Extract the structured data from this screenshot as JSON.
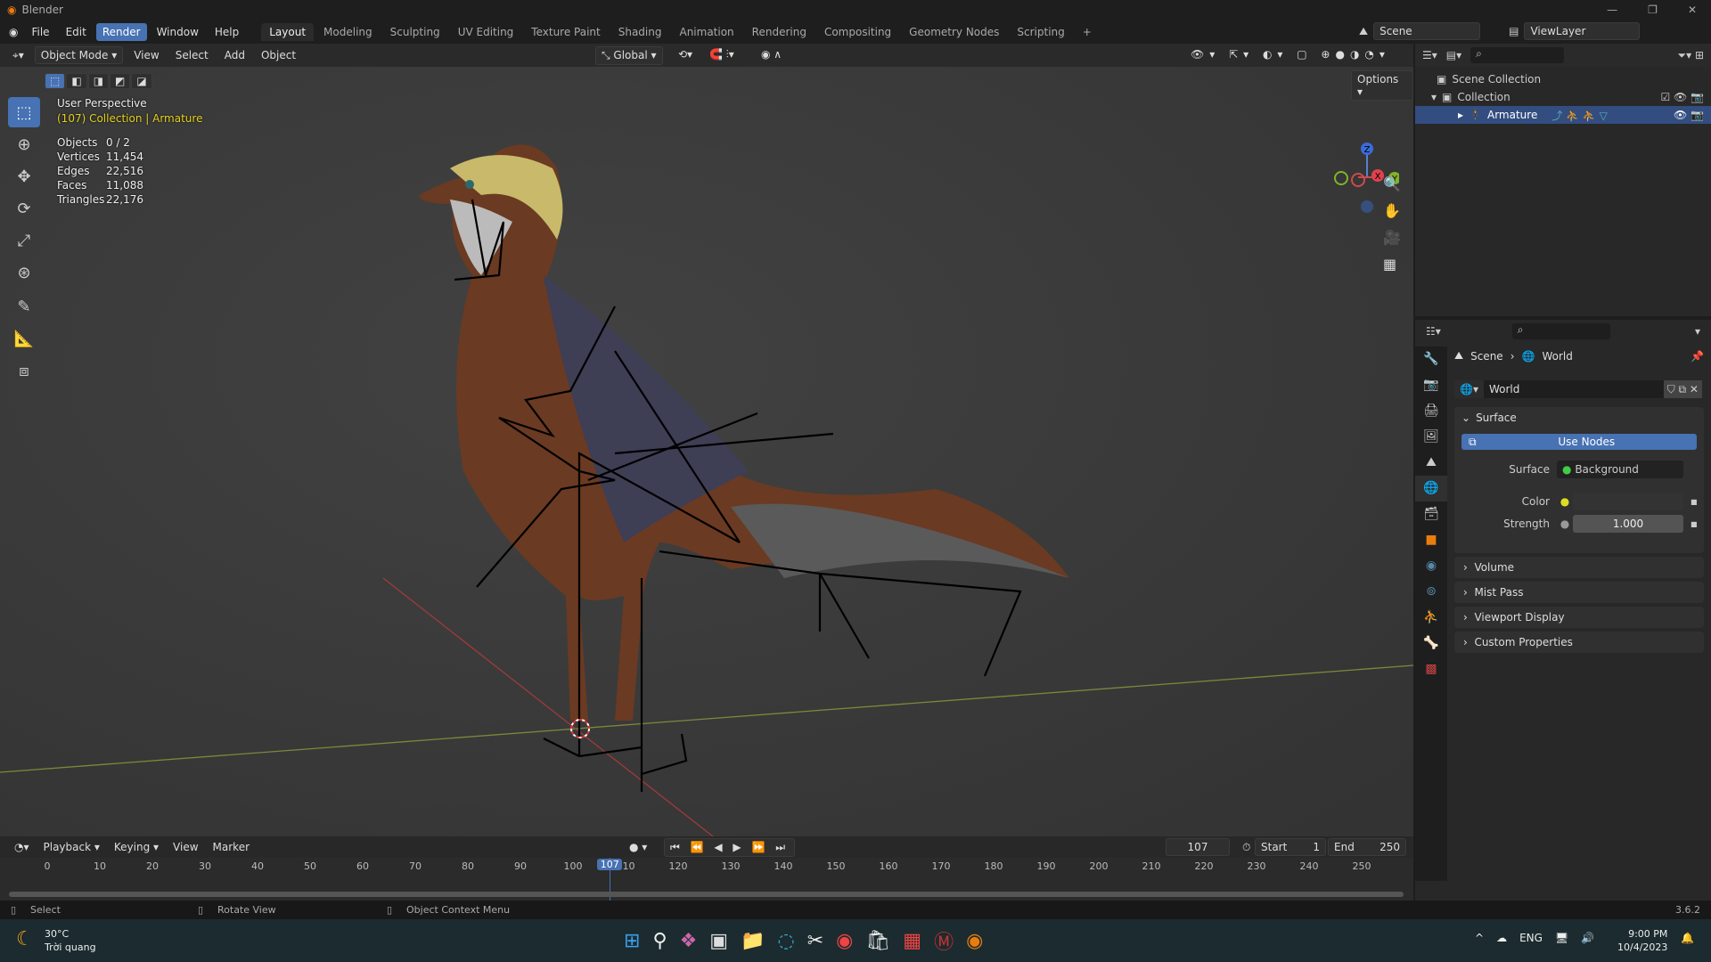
{
  "window": {
    "title": "Blender"
  },
  "menu": [
    "File",
    "Edit",
    "Render",
    "Window",
    "Help"
  ],
  "active_menu": "Render",
  "workspaces": [
    "Layout",
    "Modeling",
    "Sculpting",
    "UV Editing",
    "Texture Paint",
    "Shading",
    "Animation",
    "Rendering",
    "Compositing",
    "Geometry Nodes",
    "Scripting",
    "+"
  ],
  "active_workspace": "Layout",
  "scene": "Scene",
  "view_layer": "ViewLayer",
  "viewport": {
    "mode": "Object Mode",
    "menus": [
      "View",
      "Select",
      "Add",
      "Object"
    ],
    "orientation": "Global",
    "options": "Options",
    "perspective": "User Perspective",
    "context": "(107) Collection | Armature",
    "stats": [
      {
        "label": "Objects",
        "value": "0 / 2"
      },
      {
        "label": "Vertices",
        "value": "11,454"
      },
      {
        "label": "Edges",
        "value": "22,516"
      },
      {
        "label": "Faces",
        "value": "11,088"
      },
      {
        "label": "Triangles",
        "value": "22,176"
      }
    ],
    "gizmo": {
      "x": "X",
      "y": "Y",
      "z": "Z"
    }
  },
  "outliner": {
    "root": "Scene Collection",
    "collection": "Collection",
    "item": "Armature"
  },
  "properties": {
    "breadcrumb": [
      "Scene",
      "World"
    ],
    "world_name": "World",
    "surface_header": "Surface",
    "use_nodes": "Use Nodes",
    "surface_label": "Surface",
    "surface_value": "Background",
    "color_label": "Color",
    "strength_label": "Strength",
    "strength_value": "1.000",
    "panels": [
      "Volume",
      "Mist Pass",
      "Viewport Display",
      "Custom Properties"
    ]
  },
  "timeline": {
    "menus": [
      "Playback",
      "Keying",
      "View",
      "Marker"
    ],
    "current_frame": "107",
    "start_label": "Start",
    "start": "1",
    "end_label": "End",
    "end": "250",
    "ticks": [
      "0",
      "10",
      "20",
      "30",
      "40",
      "50",
      "60",
      "70",
      "80",
      "90",
      "100",
      "110",
      "120",
      "130",
      "140",
      "150",
      "160",
      "170",
      "180",
      "190",
      "200",
      "210",
      "220",
      "230",
      "240",
      "250"
    ]
  },
  "status": {
    "select": "Select",
    "rotate": "Rotate View",
    "context_menu": "Object Context Menu",
    "version": "3.6.2"
  },
  "taskbar": {
    "temp": "30°C",
    "weather": "Trời quang",
    "lang": "ENG",
    "time": "9:00 PM",
    "date": "10/4/2023"
  }
}
